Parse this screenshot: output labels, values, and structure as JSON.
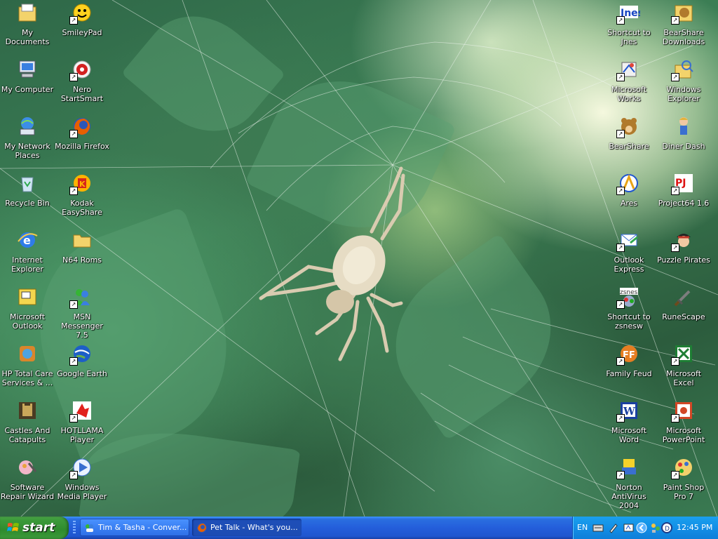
{
  "desktop": {
    "icons_left": [
      {
        "label": "My Documents",
        "icon": "my-documents-icon",
        "shortcut": false
      },
      {
        "label": "My Computer",
        "icon": "my-computer-icon",
        "shortcut": false
      },
      {
        "label": "My Network Places",
        "icon": "network-places-icon",
        "shortcut": false
      },
      {
        "label": "Recycle Bin",
        "icon": "recycle-bin-icon",
        "shortcut": false
      },
      {
        "label": "Internet Explorer",
        "icon": "internet-explorer-icon",
        "shortcut": false
      },
      {
        "label": "Microsoft Outlook",
        "icon": "outlook-icon",
        "shortcut": false
      },
      {
        "label": "HP Total Care Services & ...",
        "icon": "hp-total-care-icon",
        "shortcut": false
      },
      {
        "label": "Castles And Catapults",
        "icon": "castles-catapults-icon",
        "shortcut": false
      },
      {
        "label": "Software Repair Wizard",
        "icon": "repair-wizard-icon",
        "shortcut": false
      }
    ],
    "icons_left2": [
      {
        "label": "SmileyPad",
        "icon": "smileypad-icon",
        "shortcut": true
      },
      {
        "label": "Nero StartSmart",
        "icon": "nero-icon",
        "shortcut": true
      },
      {
        "label": "Mozilla Firefox",
        "icon": "firefox-icon",
        "shortcut": true
      },
      {
        "label": "Kodak EasyShare",
        "icon": "kodak-icon",
        "shortcut": true
      },
      {
        "label": "N64 Roms",
        "icon": "folder-icon",
        "shortcut": false
      },
      {
        "label": "MSN Messenger 7.5",
        "icon": "msn-messenger-icon",
        "shortcut": true
      },
      {
        "label": "Google Earth",
        "icon": "google-earth-icon",
        "shortcut": true
      },
      {
        "label": "HOTLLAMA Player",
        "icon": "hotllama-icon",
        "shortcut": true
      },
      {
        "label": "Windows Media Player",
        "icon": "media-player-icon",
        "shortcut": true
      }
    ],
    "icons_right1": [
      {
        "label": "Shortcut to Jnes",
        "icon": "jnes-icon",
        "shortcut": true
      },
      {
        "label": "Microsoft Works",
        "icon": "works-icon",
        "shortcut": true
      },
      {
        "label": "BearShare",
        "icon": "bearshare-icon",
        "shortcut": true
      },
      {
        "label": "Ares",
        "icon": "ares-icon",
        "shortcut": true
      },
      {
        "label": "Outlook Express",
        "icon": "outlook-express-icon",
        "shortcut": true
      },
      {
        "label": "Shortcut to zsnesw",
        "icon": "zsnes-icon",
        "shortcut": true
      },
      {
        "label": "Family Feud",
        "icon": "family-feud-icon",
        "shortcut": true
      },
      {
        "label": "Microsoft Word",
        "icon": "word-icon",
        "shortcut": true
      },
      {
        "label": "Norton AntiVirus 2004",
        "icon": "norton-icon",
        "shortcut": true
      }
    ],
    "icons_right2": [
      {
        "label": "BearShare Downloads",
        "icon": "bearshare-downloads-icon",
        "shortcut": true
      },
      {
        "label": "Windows Explorer",
        "icon": "windows-explorer-icon",
        "shortcut": true
      },
      {
        "label": "Diner Dash",
        "icon": "diner-dash-icon",
        "shortcut": false
      },
      {
        "label": "Project64 1.6",
        "icon": "project64-icon",
        "shortcut": true
      },
      {
        "label": "Puzzle Pirates",
        "icon": "puzzle-pirates-icon",
        "shortcut": true
      },
      {
        "label": "RuneScape",
        "icon": "runescape-icon",
        "shortcut": false
      },
      {
        "label": "Microsoft Excel",
        "icon": "excel-icon",
        "shortcut": true
      },
      {
        "label": "Microsoft PowerPoint",
        "icon": "powerpoint-icon",
        "shortcut": true
      },
      {
        "label": "Paint Shop Pro 7",
        "icon": "paint-shop-pro-icon",
        "shortcut": true
      }
    ]
  },
  "taskbar": {
    "start_label": "start",
    "tasks": [
      {
        "label": "Tim & Tasha - Conver...",
        "icon": "msn-chat-icon",
        "active": false
      },
      {
        "label": "Pet Talk - What's you...",
        "icon": "firefox-icon",
        "active": true
      }
    ],
    "tray": {
      "language": "EN",
      "clock": "12:45 PM"
    }
  },
  "colors": {
    "taskbar_blue": "#245edb",
    "start_green": "#3c9a3a",
    "tray_blue": "#138fe6"
  }
}
